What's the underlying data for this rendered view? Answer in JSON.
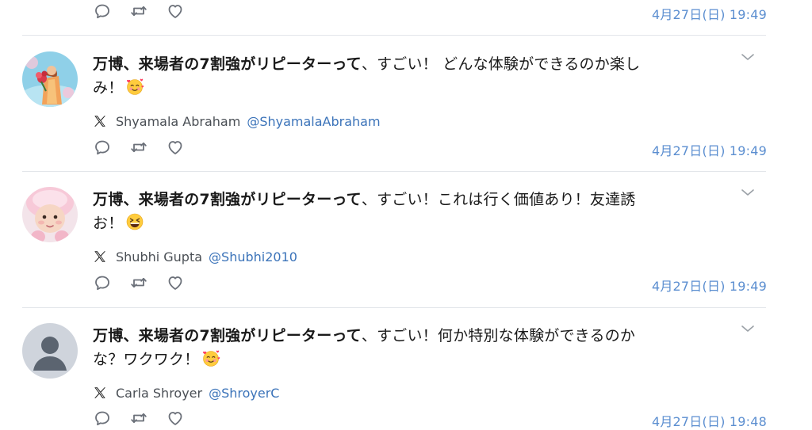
{
  "top_row": {
    "timestamp": "4月27日(日) 19:49"
  },
  "tweets": [
    {
      "text_bold": "万博、来場者の7割強がリピーターって",
      "text_line1_rest": "、すごい！ どんな体験ができるのか楽し",
      "text_line2": "み！",
      "emoji": "smiling-face-with-hearts",
      "author_name": "Shyamala Abraham",
      "author_handle": "@ShyamalaAbraham",
      "timestamp": "4月27日(日) 19:49",
      "avatar": "woman-with-bouquet-photo"
    },
    {
      "text_bold": "万博、来場者の7割強がリピーターって",
      "text_line1_rest": "、すごい！これは行く価値あり！友達誘",
      "text_line2": "お！",
      "emoji": "grinning-squinting-face",
      "author_name": "Shubhi Gupta",
      "author_handle": "@Shubhi2010",
      "timestamp": "4月27日(日) 19:49",
      "avatar": "baby-in-pink-hat-photo"
    },
    {
      "text_bold": "万博、来場者の7割強がリピーターって",
      "text_line1_rest": "、すごい！何か特別な体験ができるのか",
      "text_line2": "な？ワクワク！",
      "emoji": "smiling-face-with-hearts",
      "author_name": "Carla Shroyer",
      "author_handle": "@ShroyerC",
      "timestamp": "4月27日(日) 19:48",
      "avatar": "default-silhouette"
    }
  ],
  "colors": {
    "link": "#3b73b9",
    "timestamp": "#5b8ed0",
    "icon": "#6b7079",
    "divider": "#e3e6ea"
  },
  "icons": {
    "reply": "speech-bubble-icon",
    "retweet": "retweet-arrows-icon",
    "like": "heart-outline-icon",
    "more": "chevron-down-icon",
    "source": "x-logo-icon"
  }
}
